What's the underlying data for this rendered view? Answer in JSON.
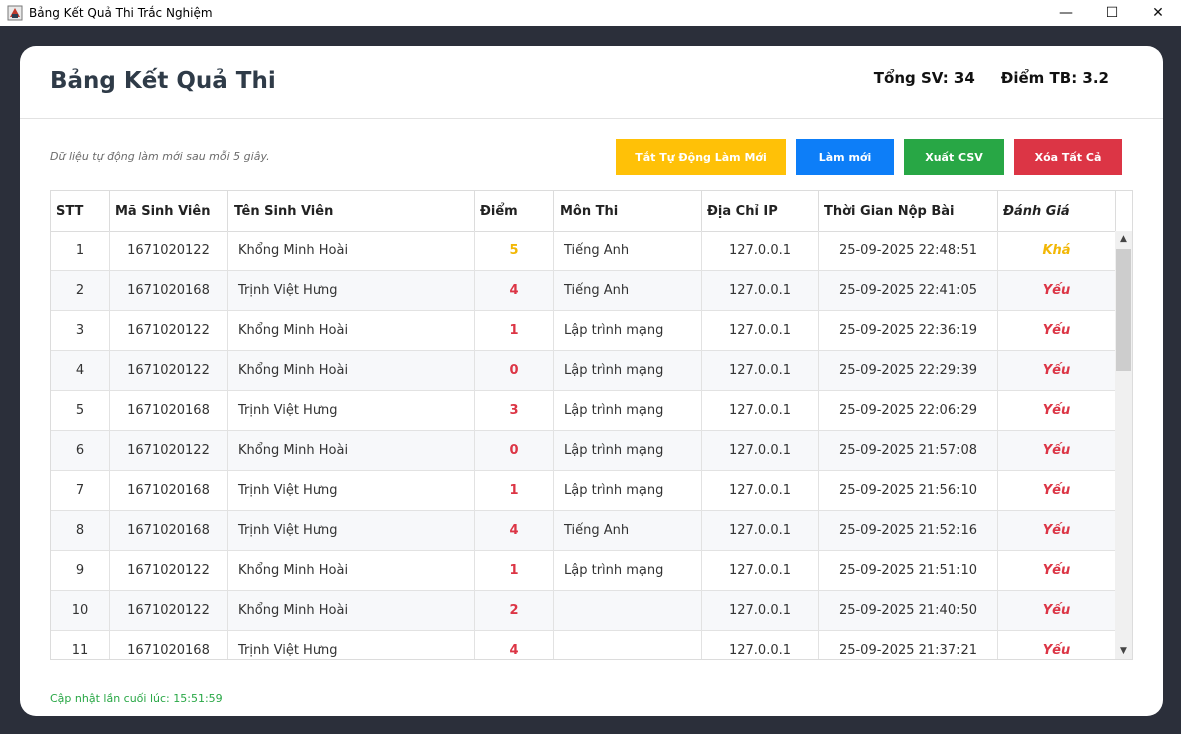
{
  "window": {
    "title": "Bảng Kết Quả Thi Trắc Nghiệm",
    "minimize_glyph": "—",
    "maximize_glyph": "☐",
    "close_glyph": "✕"
  },
  "header": {
    "title": "Bảng Kết Quả Thi",
    "total_students": "Tổng SV: 34",
    "average_score": "Điểm TB: 3.2"
  },
  "refresh_note": "Dữ liệu tự động làm mới sau mỗi 5 giây.",
  "toolbar": {
    "toggle_auto_refresh": "Tắt Tự Động Làm Mới",
    "refresh": "Làm mới",
    "export_csv": "Xuất CSV",
    "clear_all": "Xóa Tất Cả"
  },
  "table": {
    "columns": [
      "STT",
      "Mã Sinh Viên",
      "Tên Sinh Viên",
      "Điểm",
      "Môn Thi",
      "Địa Chỉ IP",
      "Thời Gian Nộp Bài",
      "Đánh Giá"
    ],
    "rows": [
      {
        "stt": "1",
        "student_id": "1671020122",
        "name": "Khổng Minh Hoài",
        "score": "5",
        "subject": "Tiếng Anh",
        "ip": "127.0.0.1",
        "submitted": "25-09-2025 22:48:51",
        "grade": "Khá"
      },
      {
        "stt": "2",
        "student_id": "1671020168",
        "name": "Trịnh Việt Hưng",
        "score": "4",
        "subject": "Tiếng Anh",
        "ip": "127.0.0.1",
        "submitted": "25-09-2025 22:41:05",
        "grade": "Yếu"
      },
      {
        "stt": "3",
        "student_id": "1671020122",
        "name": "Khổng Minh Hoài",
        "score": "1",
        "subject": "Lập trình mạng",
        "ip": "127.0.0.1",
        "submitted": "25-09-2025 22:36:19",
        "grade": "Yếu"
      },
      {
        "stt": "4",
        "student_id": "1671020122",
        "name": "Khổng Minh Hoài",
        "score": "0",
        "subject": "Lập trình mạng",
        "ip": "127.0.0.1",
        "submitted": "25-09-2025 22:29:39",
        "grade": "Yếu"
      },
      {
        "stt": "5",
        "student_id": "1671020168",
        "name": "Trịnh Việt Hưng",
        "score": "3",
        "subject": "Lập trình mạng",
        "ip": "127.0.0.1",
        "submitted": "25-09-2025 22:06:29",
        "grade": "Yếu"
      },
      {
        "stt": "6",
        "student_id": "1671020122",
        "name": "Khổng Minh Hoài",
        "score": "0",
        "subject": "Lập trình mạng",
        "ip": "127.0.0.1",
        "submitted": "25-09-2025 21:57:08",
        "grade": "Yếu"
      },
      {
        "stt": "7",
        "student_id": "1671020168",
        "name": "Trịnh Việt Hưng",
        "score": "1",
        "subject": "Lập trình mạng",
        "ip": "127.0.0.1",
        "submitted": "25-09-2025 21:56:10",
        "grade": "Yếu"
      },
      {
        "stt": "8",
        "student_id": "1671020168",
        "name": "Trịnh Việt Hưng",
        "score": "4",
        "subject": "Tiếng Anh",
        "ip": "127.0.0.1",
        "submitted": "25-09-2025 21:52:16",
        "grade": "Yếu"
      },
      {
        "stt": "9",
        "student_id": "1671020122",
        "name": "Khổng Minh Hoài",
        "score": "1",
        "subject": "Lập trình mạng",
        "ip": "127.0.0.1",
        "submitted": "25-09-2025 21:51:10",
        "grade": "Yếu"
      },
      {
        "stt": "10",
        "student_id": "1671020122",
        "name": "Khổng Minh Hoài",
        "score": "2",
        "subject": "",
        "ip": "127.0.0.1",
        "submitted": "25-09-2025 21:40:50",
        "grade": "Yếu"
      },
      {
        "stt": "11",
        "student_id": "1671020168",
        "name": "Trịnh Việt Hưng",
        "score": "4",
        "subject": "",
        "ip": "127.0.0.1",
        "submitted": "25-09-2025 21:37:21",
        "grade": "Yếu"
      }
    ]
  },
  "footer": {
    "last_updated": "Cập nhật lần cuối lúc: 15:51:59"
  },
  "colors": {
    "good": "#f2b705",
    "weak": "#dc3545",
    "background": "#2b2f3a",
    "toggle_button": "#ffc107",
    "refresh_button": "#0d7ef8",
    "csv_button": "#28a745",
    "clear_button": "#dc3545",
    "footer_text": "#28a745"
  }
}
